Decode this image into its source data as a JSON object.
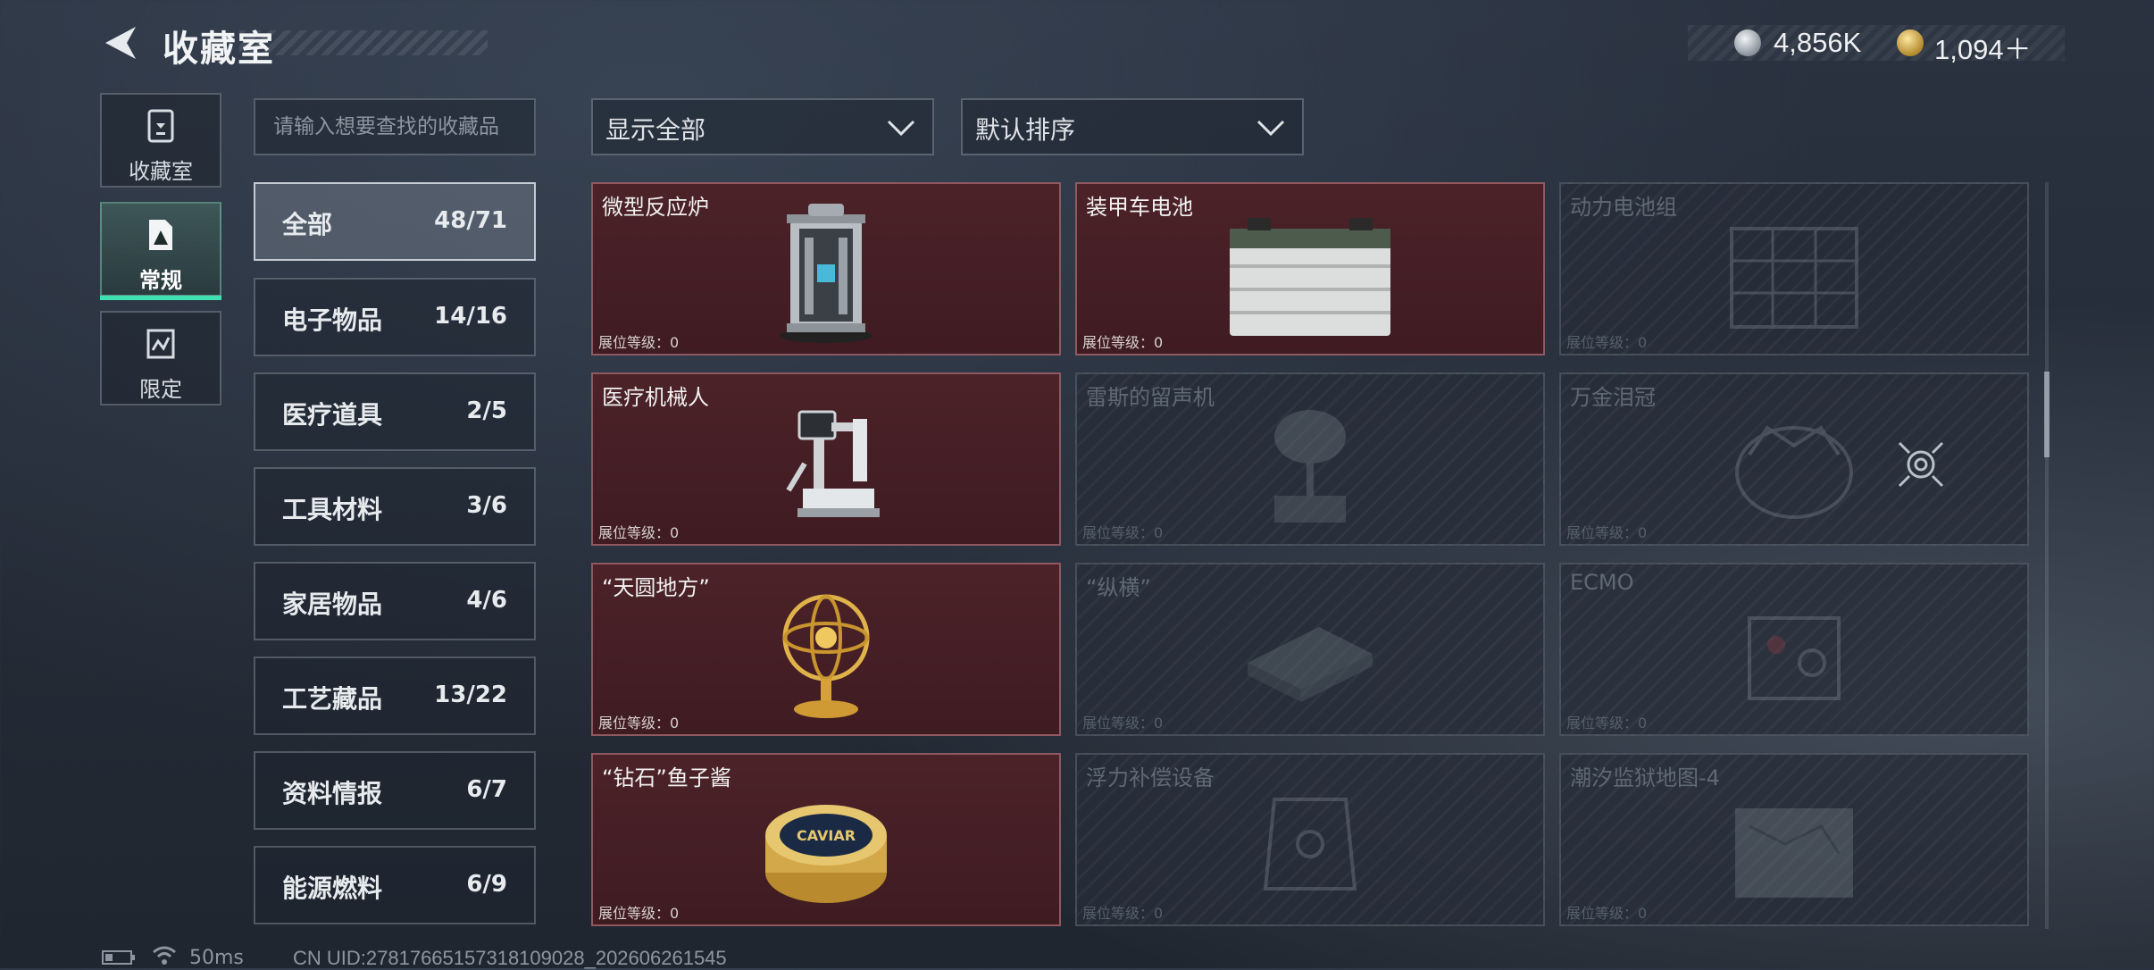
{
  "header": {
    "title": "收藏室"
  },
  "currency": [
    {
      "name": "silver-coin-icon",
      "value": "4,856K"
    },
    {
      "name": "gold-coin-icon",
      "value": "1,094＋"
    }
  ],
  "nav": [
    {
      "label": "收藏室",
      "icon": "vault-icon",
      "active": false
    },
    {
      "label": "常规",
      "icon": "regular-collection-icon",
      "active": true
    },
    {
      "label": "限定",
      "icon": "limited-collection-icon",
      "active": false
    }
  ],
  "search": {
    "placeholder": "请输入想要查找的收藏品"
  },
  "filters": {
    "display": "显示全部",
    "sort": "默认排序"
  },
  "categories": [
    {
      "label": "全部",
      "count": "48/71"
    },
    {
      "label": "电子物品",
      "count": "14/16"
    },
    {
      "label": "医疗道具",
      "count": "2/5"
    },
    {
      "label": "工具材料",
      "count": "3/6"
    },
    {
      "label": "家居物品",
      "count": "4/6"
    },
    {
      "label": "工艺藏品",
      "count": "13/22"
    },
    {
      "label": "资料情报",
      "count": "6/7"
    },
    {
      "label": "能源燃料",
      "count": "6/9"
    }
  ],
  "level_label": "展位等级：0",
  "items": [
    {
      "name": "微型反应炉",
      "owned": true,
      "icon": "reactor-icon"
    },
    {
      "name": "装甲车电池",
      "owned": true,
      "icon": "battery-icon"
    },
    {
      "name": "动力电池组",
      "owned": false,
      "icon": "battery-pack-icon"
    },
    {
      "name": "医疗机械人",
      "owned": true,
      "icon": "medical-robot-icon"
    },
    {
      "name": "雷斯的留声机",
      "owned": false,
      "icon": "phonograph-icon"
    },
    {
      "name": "万金泪冠",
      "owned": false,
      "icon": "crown-icon"
    },
    {
      "name": "“天圆地方”",
      "owned": true,
      "icon": "armillary-sphere-icon"
    },
    {
      "name": "“纵横”",
      "owned": false,
      "icon": "chessboard-icon"
    },
    {
      "name": "ECMO",
      "owned": false,
      "icon": "ecmo-icon"
    },
    {
      "name": "“钻石”鱼子酱",
      "owned": true,
      "icon": "caviar-tin-icon"
    },
    {
      "name": "浮力补偿设备",
      "owned": false,
      "icon": "bcd-vest-icon"
    },
    {
      "name": "潮汐监狱地图-4",
      "owned": false,
      "icon": "map-icon"
    }
  ],
  "caviar_lid_text": "CAVIAR",
  "status": {
    "ping": "50ms",
    "uid": "CN UID:27817665157318109028_202606261545"
  }
}
